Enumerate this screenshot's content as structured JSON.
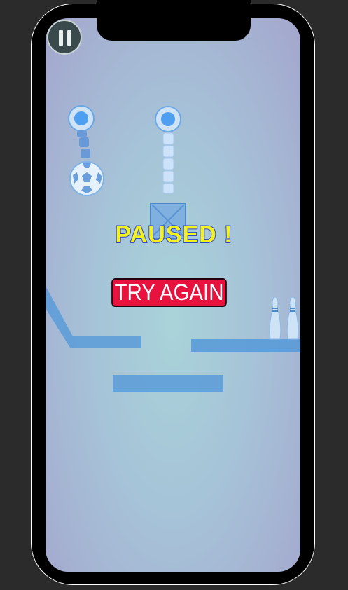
{
  "game": {
    "status_title": "PAUSED !",
    "try_again_label": "TRY AGAIN"
  },
  "icons": {
    "pause": "pause-icon",
    "ball": "soccer-ball-icon",
    "pin": "bowling-pin-icon",
    "anchor": "rope-anchor-icon",
    "crate": "crate-icon"
  },
  "colors": {
    "background_outer": "#2b2b2b",
    "title_fill": "#f4f21c",
    "title_stroke": "#3346c8",
    "button_bg": "#e8123f",
    "platform": "#5a9bd8"
  }
}
